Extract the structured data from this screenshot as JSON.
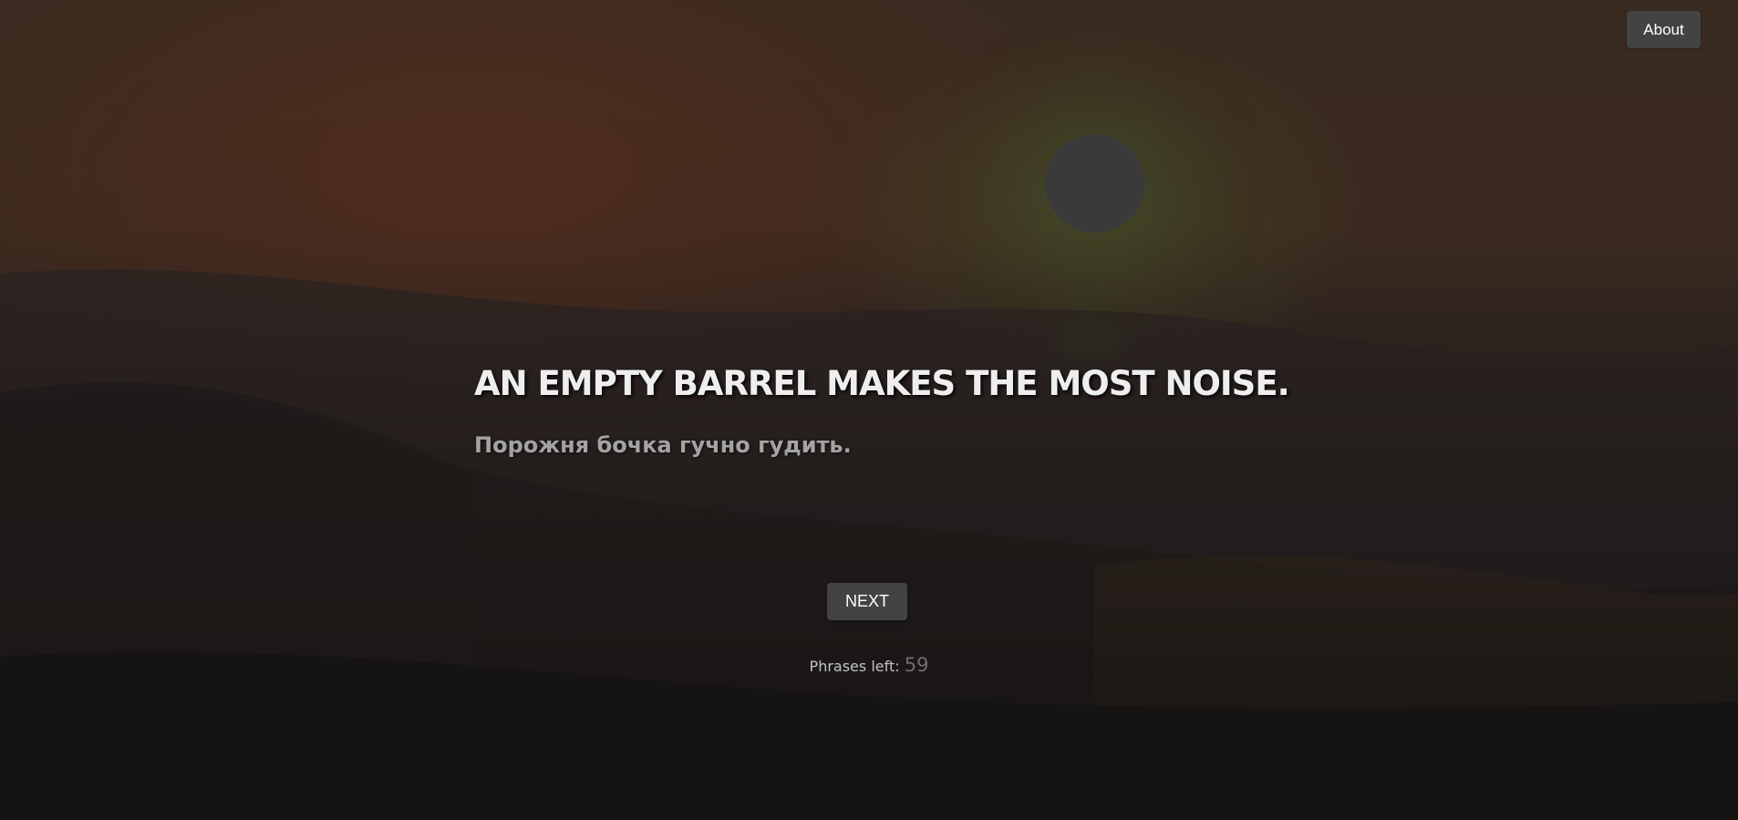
{
  "header": {
    "about_label": "About"
  },
  "phrase": {
    "english": "AN EMPTY BARREL MAKES THE MOST NOISE.",
    "ukrainian": "Порожня бочка гучно гудить."
  },
  "controls": {
    "next_label": "NEXT"
  },
  "counter": {
    "label": "Phrases left:",
    "value": "59"
  },
  "colors": {
    "button_bg": "#434343",
    "title_text": "#eeeeee",
    "subtitle_text": "#a3a3a3"
  }
}
